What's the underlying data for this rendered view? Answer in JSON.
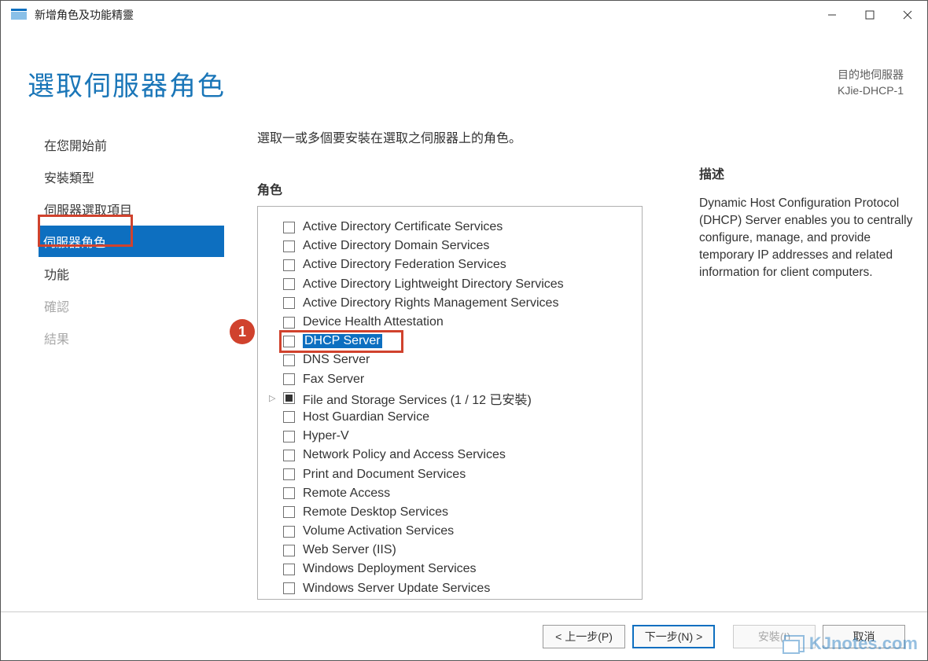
{
  "titlebar": {
    "title": "新增角色及功能精靈"
  },
  "header": {
    "page_title": "選取伺服器角色",
    "dest_label": "目的地伺服器",
    "dest_server": "KJie-DHCP-1"
  },
  "sidebar": {
    "items": [
      {
        "label": "在您開始前",
        "state": "normal"
      },
      {
        "label": "安裝類型",
        "state": "normal"
      },
      {
        "label": "伺服器選取項目",
        "state": "normal"
      },
      {
        "label": "伺服器角色",
        "state": "active"
      },
      {
        "label": "功能",
        "state": "normal"
      },
      {
        "label": "確認",
        "state": "disabled"
      },
      {
        "label": "結果",
        "state": "disabled"
      }
    ]
  },
  "main": {
    "instruction": "選取一或多個要安裝在選取之伺服器上的角色。",
    "roles_label": "角色",
    "roles": [
      {
        "label": "Active Directory Certificate Services",
        "checked": "none"
      },
      {
        "label": "Active Directory Domain Services",
        "checked": "none"
      },
      {
        "label": "Active Directory Federation Services",
        "checked": "none"
      },
      {
        "label": "Active Directory Lightweight Directory Services",
        "checked": "none"
      },
      {
        "label": "Active Directory Rights Management Services",
        "checked": "none"
      },
      {
        "label": "Device Health Attestation",
        "checked": "none"
      },
      {
        "label": "DHCP Server",
        "checked": "none",
        "selected": true
      },
      {
        "label": "DNS Server",
        "checked": "none"
      },
      {
        "label": "Fax Server",
        "checked": "none"
      },
      {
        "label": "File and Storage Services (1 / 12 已安裝)",
        "checked": "some",
        "expandable": true
      },
      {
        "label": "Host Guardian Service",
        "checked": "none"
      },
      {
        "label": "Hyper-V",
        "checked": "none"
      },
      {
        "label": "Network Policy and Access Services",
        "checked": "none"
      },
      {
        "label": "Print and Document Services",
        "checked": "none"
      },
      {
        "label": "Remote Access",
        "checked": "none"
      },
      {
        "label": "Remote Desktop Services",
        "checked": "none"
      },
      {
        "label": "Volume Activation Services",
        "checked": "none"
      },
      {
        "label": "Web Server (IIS)",
        "checked": "none"
      },
      {
        "label": "Windows Deployment Services",
        "checked": "none"
      },
      {
        "label": "Windows Server Update Services",
        "checked": "none"
      }
    ]
  },
  "description": {
    "label": "描述",
    "text": "Dynamic Host Configuration Protocol (DHCP) Server enables you to centrally configure, manage, and provide temporary IP addresses and related information for client computers."
  },
  "footer": {
    "prev": "< 上一步(P)",
    "next": "下一步(N) >",
    "install": "安裝(I)",
    "cancel": "取消"
  },
  "annotation": {
    "badge": "1"
  },
  "watermark": "KJnotes.com"
}
